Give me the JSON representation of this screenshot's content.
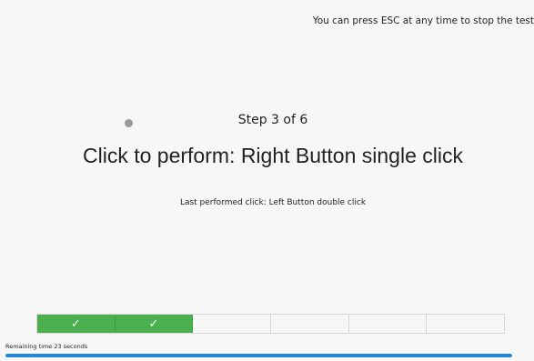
{
  "header": {
    "esc_hint": "You can press ESC at any time to stop the test"
  },
  "main": {
    "step_label": "Step 3 of 6",
    "instruction": "Click to perform: Right Button single click",
    "last_click": "Last performed click:  Left Button double click"
  },
  "progress": {
    "total_steps": 6,
    "completed_steps": 2,
    "steps": [
      {
        "status": "done",
        "mark": "✓"
      },
      {
        "status": "done",
        "mark": "✓"
      },
      {
        "status": "pending",
        "mark": ""
      },
      {
        "status": "pending",
        "mark": ""
      },
      {
        "status": "pending",
        "mark": ""
      },
      {
        "status": "pending",
        "mark": ""
      }
    ],
    "done_color": "#4caf50"
  },
  "timer": {
    "remaining_text": "Remaining time 23 seconds",
    "fraction_remaining": 1.0,
    "bar_color": "#1e88e5"
  }
}
